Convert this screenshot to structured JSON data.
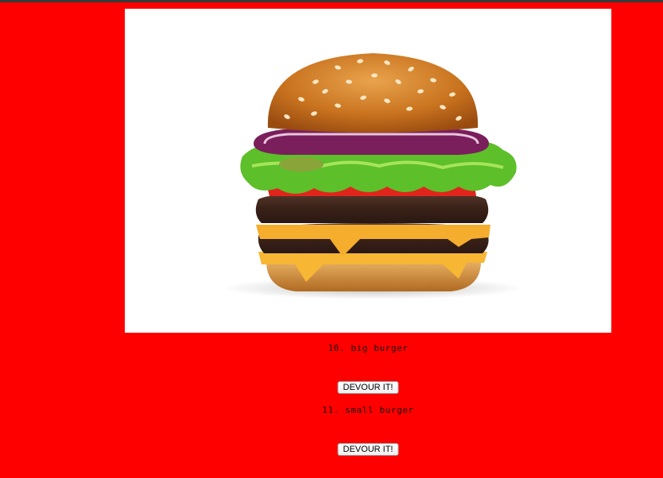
{
  "hero_image": {
    "alt_icon": "burger-photo",
    "background": "#ffffff"
  },
  "page": {
    "background": "#ff0000"
  },
  "burgers": [
    {
      "name": "10. big burger",
      "button_label": "DEVOUR IT!"
    },
    {
      "name": "11. small burger",
      "button_label": "DEVOUR IT!"
    }
  ]
}
